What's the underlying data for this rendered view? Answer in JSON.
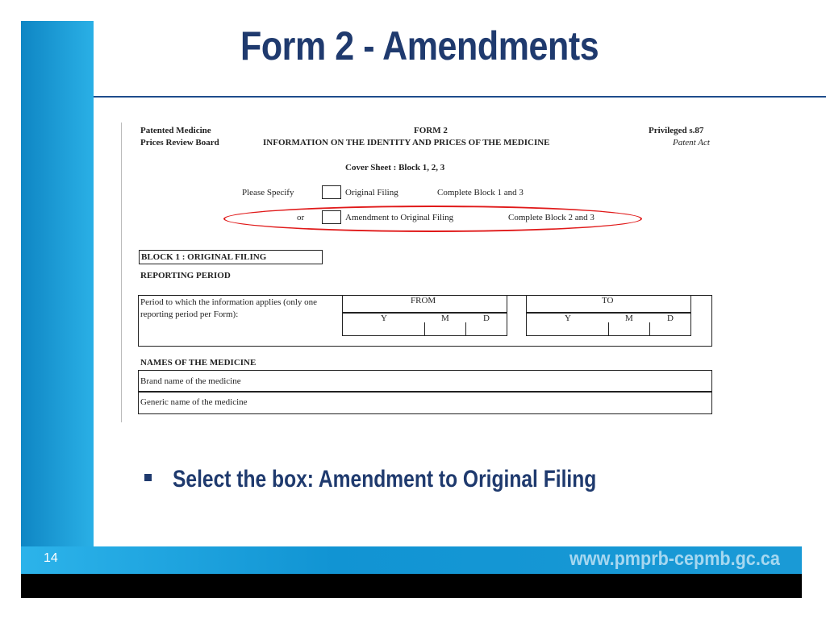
{
  "slide": {
    "title": "Form 2 - Amendments",
    "bullet": "Select the box: Amendment to Original Filing",
    "page_number": "14",
    "footer_url": "www.pmprb-cepmb.gc.ca"
  },
  "form": {
    "org_line1": "Patented Medicine",
    "org_line2": "Prices Review Board",
    "form_title": "FORM 2",
    "form_subtitle": "INFORMATION ON THE IDENTITY AND PRICES OF THE MEDICINE",
    "privileged": "Privileged s.87",
    "patent_act": "Patent Act",
    "cover_sheet": "Cover Sheet : Block 1, 2, 3",
    "please_specify": "Please Specify",
    "original_filing": "Original Filing",
    "complete_1_3": "Complete Block 1 and 3",
    "or": "or",
    "amendment": "Amendment to Original Filing",
    "complete_2_3": "Complete Block 2 and 3",
    "block1_title": "BLOCK 1 : ORIGINAL FILING",
    "reporting_period": "REPORTING PERIOD",
    "period_desc": "Period to which the information applies (only one reporting period per Form):",
    "from_label": "FROM",
    "to_label": "TO",
    "y": "Y",
    "m": "M",
    "d": "D",
    "names_title": "NAMES OF THE MEDICINE",
    "brand_name": "Brand name of the medicine",
    "generic_name": "Generic name of the medicine"
  }
}
